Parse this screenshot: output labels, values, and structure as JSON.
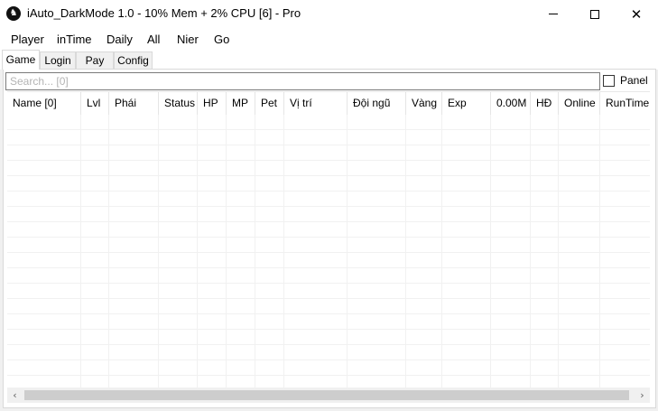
{
  "window": {
    "title": "iAuto_DarkMode 1.0 - 10% Mem + 2% CPU [6] - Pro",
    "app_icon_glyph": "♞",
    "close_glyph": "✕"
  },
  "menu": {
    "items": [
      {
        "label": "Player"
      },
      {
        "label": "inTime"
      },
      {
        "label": "Daily"
      },
      {
        "label": "All"
      },
      {
        "label": "Nier"
      },
      {
        "label": "Go"
      }
    ]
  },
  "tabs": [
    {
      "label": "Game",
      "active": true
    },
    {
      "label": "Login",
      "active": false
    },
    {
      "label": "Pay",
      "active": false
    },
    {
      "label": "Config",
      "active": false
    }
  ],
  "search": {
    "value": "",
    "placeholder": "Search... [0]"
  },
  "panel_toggle": {
    "label": "Panel",
    "checked": false
  },
  "grid": {
    "columns": [
      {
        "label": "Name [0]"
      },
      {
        "label": "Lvl"
      },
      {
        "label": "Phái"
      },
      {
        "label": "Status"
      },
      {
        "label": "HP"
      },
      {
        "label": "MP"
      },
      {
        "label": "Pet"
      },
      {
        "label": "Vị trí"
      },
      {
        "label": "Đội ngũ"
      },
      {
        "label": "Vàng"
      },
      {
        "label": "Exp"
      },
      {
        "label": "0.00M"
      },
      {
        "label": "HĐ"
      },
      {
        "label": "Online"
      },
      {
        "label": "RunTime"
      }
    ],
    "rows": []
  },
  "scrollbar": {
    "left_glyph": "‹",
    "right_glyph": "›"
  }
}
